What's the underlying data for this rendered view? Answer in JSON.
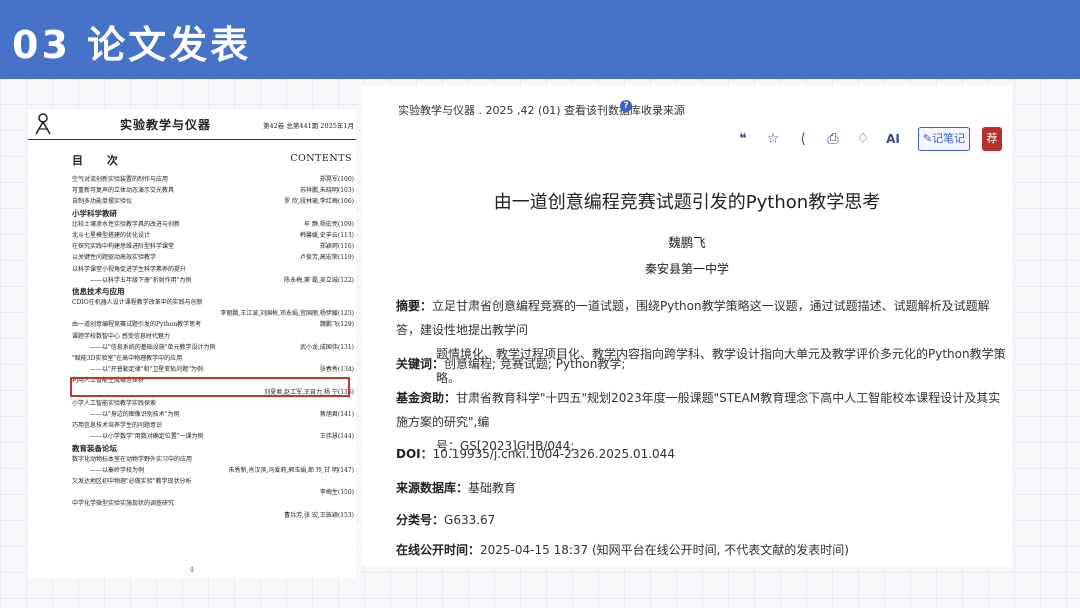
{
  "header": {
    "title": "03 论文发表"
  },
  "toc": {
    "journal": "实验教学与仪器",
    "issue": "第42卷 总第441期 2025年1月",
    "mulu": "目 次",
    "contents": "CONTENTS",
    "lines": [
      {
        "t": "空气对流创新实验装置的制作与应用",
        "a": "郑晃军(100)"
      },
      {
        "t": "可重新可复声的立体动态演示交光教具",
        "a": "苏祥鹏,朱晓明(103)"
      },
      {
        "t": "自制多功能单摆实验仪",
        "a": "罗 欣,段林瑜,李红梅(106)"
      },
      {
        "section": "小学科学教研"
      },
      {
        "t": "比较土壤渗水性实验教学具的改进与创新",
        "a": "牟 静,杨宏亮(109)"
      },
      {
        "t": "北斗七星模型搭建的优化设计",
        "a": "韩馨媛,史丰云(113)"
      },
      {
        "t": "在探究实践中构建思维进阶型科学课堂",
        "a": "郑颖珂(116)"
      },
      {
        "t": "以关键性问题驱动高效实验教学",
        "a": "卢俊芳,高宏荣(119)"
      },
      {
        "t": "以科学课堂小视角促进学生科学素养的提升",
        "a": ""
      },
      {
        "t": "——以科学五年级下册\"折射作用\"为例",
        "a": "陈永梅,窦 磊,吴立城(122)",
        "sub": true
      },
      {
        "section": "信息技术与应用"
      },
      {
        "t": "CDIO在机器人设计课程教学改革中的实践与创新",
        "a": ""
      },
      {
        "t": "",
        "a": "李丽鹏,王江波,刘国彬,邓永娟,宫国丽,杨伊媛(125)"
      },
      {
        "t": "由一道创意编程竞赛试题引发的Python教学思考",
        "a": "魏鹏飞(129)"
      },
      {
        "t": "课题学校数智中心 感受信息时代魅力",
        "a": ""
      },
      {
        "t": "——以\"信息系统的基础设施\"单元教学设计为例",
        "a": "武小龙,成国伟(131)",
        "sub": true
      },
      {
        "t": "\"赋能3D实验室\"在高中物理教学中的应用",
        "a": ""
      },
      {
        "t": "——以\"开普勒定律\"和\"卫星变轨问题\"为例",
        "a": "张春秀(134)",
        "sub": true
      },
      {
        "t": "利用人工智能生成概念探析",
        "a": ""
      },
      {
        "t": "",
        "a": "刘夏君,赵工军,王宵力,杨 宁(136)"
      },
      {
        "t": "小学人工智能实验教学实践探索",
        "a": ""
      },
      {
        "t": "——以\"身边的图像识别技术\"为例",
        "a": "蔡旭君(141)",
        "sub": true
      },
      {
        "t": "巧用信息技术培养学生的问题意识",
        "a": ""
      },
      {
        "t": "——以小学数学\"用数对确定位置\"一课为例",
        "a": "王伟慧(144)",
        "sub": true
      },
      {
        "section": "教育装备论坛"
      },
      {
        "t": "数字化动物标本室在动物学野外实习中的应用",
        "a": ""
      },
      {
        "t": "——以秦岭学校为例",
        "a": "朱秀新,肖汉滨,冯爱莉,郭玉娟,郎 玲,甘 明(147)",
        "sub": true
      },
      {
        "t": "欠发达地区初中物理\"必做实验\"教学现状分析",
        "a": ""
      },
      {
        "t": "",
        "a": "李梅生(150)"
      },
      {
        "t": "中学化学微型实验实施现状的调查研究",
        "a": ""
      },
      {
        "t": "",
        "a": "曹兵芳,张 宏,王旌颖(153)"
      }
    ],
    "page_mark": "·I·"
  },
  "article": {
    "source": "实验教学与仪器 . 2025 ,42 (01)  查看该刊数据库收录来源",
    "help_icon": "?",
    "toolbar": {
      "quote_icon": "❝",
      "star_icon": "☆",
      "share_icon": "⟨",
      "print_icon": "⎙",
      "bell_icon": "♢",
      "ai_label": "AI",
      "note_label": "✎记笔记",
      "fav_label": "荐"
    },
    "title": "由一道创意编程竞赛试题引发的Python教学思考",
    "author": "魏鹏飞",
    "affiliation": "秦安县第一中学",
    "abstract_label": "摘要：",
    "abstract_line1": "立足甘肃省创意编程竞赛的一道试题，围绕Python教学策略这一议题，通过试题描述、试题解析及试题解答，建设性地提出教学问",
    "abstract_line2": "题情境化、教学过程项目化、教学内容指向跨学科、教学设计指向大单元及教学评价多元化的Python教学策略。",
    "keywords_label": "关键词：",
    "keywords": "创意编程;  竞赛试题;  Python教学;",
    "fund_label": "基金资助：",
    "fund_line1": "甘肃省教育科学\"十四五\"规划2023年度一般课题\"STEAM教育理念下高中人工智能校本课程设计及其实施方案的研究\",编",
    "fund_line2": "号：GS[2023]GHB/044;",
    "doi_label": "DOI：",
    "doi": "10.19935/j.cnki.1004-2326.2025.01.044",
    "db_label": "来源数据库：",
    "db": "基础教育",
    "class_label": "分类号：",
    "class_no": "G633.67",
    "online_label": "在线公开时间：",
    "online": "2025-04-15 18:37 (知网平台在线公开时间, 不代表文献的发表时间)"
  }
}
